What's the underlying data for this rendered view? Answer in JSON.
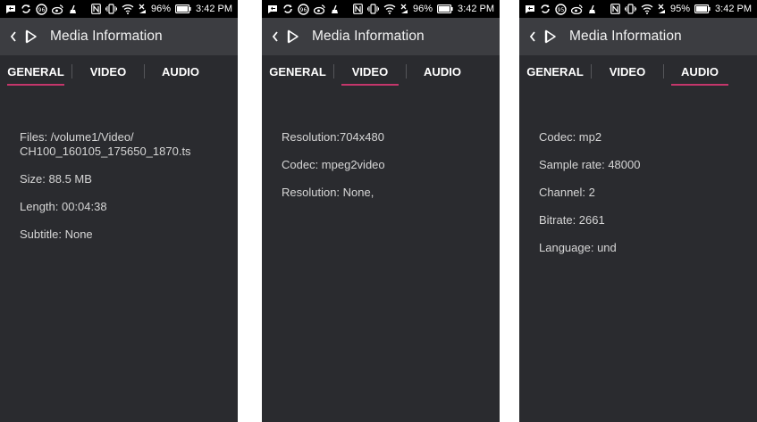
{
  "screens": [
    {
      "status": {
        "battery_pct": "96%",
        "time": "3:42 PM"
      },
      "app": {
        "title": "Media Information"
      },
      "tabs": [
        "GENERAL",
        "VIDEO",
        "AUDIO"
      ],
      "active_tab": "GENERAL",
      "lines": [
        "Files: /volume1/Video/\nCH100_160105_175650_1870.ts",
        "Size: 88.5 MB",
        "Length: 00:04:38",
        "Subtitle: None"
      ]
    },
    {
      "status": {
        "battery_pct": "96%",
        "time": "3:42 PM"
      },
      "app": {
        "title": "Media Information"
      },
      "tabs": [
        "GENERAL",
        "VIDEO",
        "AUDIO"
      ],
      "active_tab": "VIDEO",
      "lines": [
        "Resolution:704x480",
        "Codec: mpeg2video",
        "Resolution: None,"
      ]
    },
    {
      "status": {
        "battery_pct": "95%",
        "time": "3:42 PM"
      },
      "app": {
        "title": "Media Information"
      },
      "tabs": [
        "GENERAL",
        "VIDEO",
        "AUDIO"
      ],
      "active_tab": "AUDIO",
      "lines": [
        "Codec: mp2",
        "Sample rate: 48000",
        "Channel: 2",
        "Bitrate: 2661",
        "Language: und"
      ]
    }
  ],
  "status_icons": {
    "left": [
      "message-icon",
      "sync-icon",
      "data-usage-icon",
      "weibo-icon",
      "cleanup-icon"
    ],
    "right": [
      "nfc-icon",
      "vibrate-icon",
      "wifi-icon",
      "signal-off-icon",
      "battery-icon"
    ]
  },
  "colors": {
    "background": "#2a2b2f",
    "appbar": "#3c3d41",
    "statusbar": "#000000",
    "accent_underline": "#c4366b",
    "text": "#d6d6d6"
  }
}
